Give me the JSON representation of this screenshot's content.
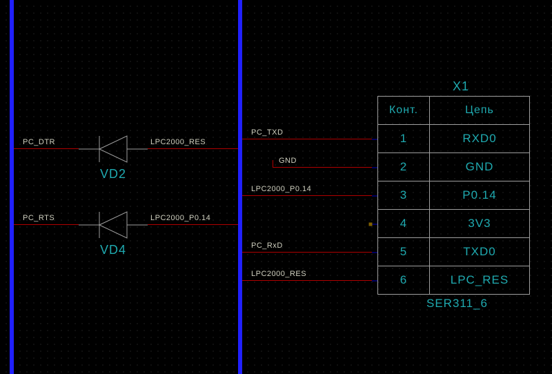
{
  "connector": {
    "designator": "X1",
    "type": "SER311_6",
    "headers": {
      "pin": "Конт.",
      "net": "Цепь"
    },
    "rows": [
      {
        "pin": "1",
        "net": "RXD0"
      },
      {
        "pin": "2",
        "net": "GND"
      },
      {
        "pin": "3",
        "net": "P0.14"
      },
      {
        "pin": "4",
        "net": "3V3"
      },
      {
        "pin": "5",
        "net": "TXD0"
      },
      {
        "pin": "6",
        "net": "LPC_RES"
      }
    ]
  },
  "diodes": {
    "d1": {
      "ref": "VD2",
      "left_net": "PC_DTR",
      "right_net": "LPC2000_RES"
    },
    "d2": {
      "ref": "VD4",
      "left_net": "PC_RTS",
      "right_net": "LPC2000_P0.14"
    }
  },
  "right_nets": {
    "n1": "PC_TXD",
    "n2": "GND",
    "n3": "LPC2000_P0.14",
    "n4": "PC_RxD",
    "n5": "LPC2000_RES"
  }
}
